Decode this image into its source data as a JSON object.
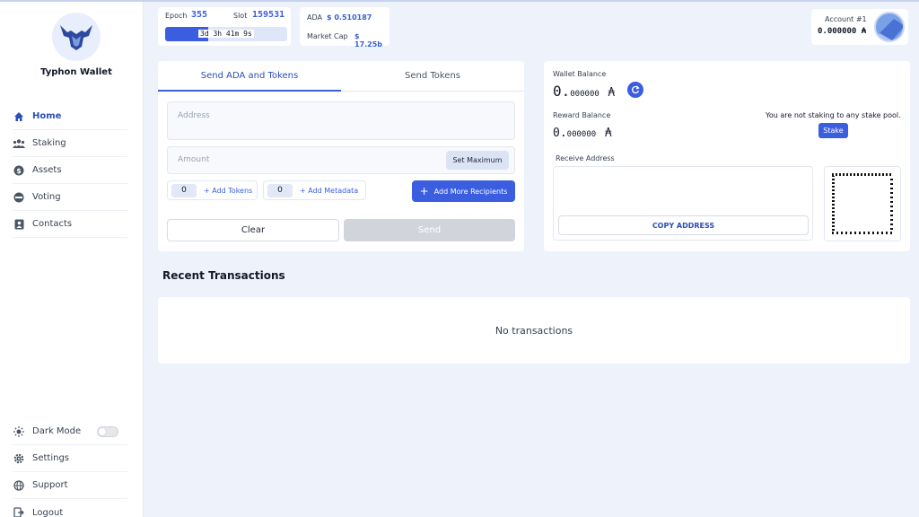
{
  "brand": {
    "name": "Typhon Wallet"
  },
  "sidebar": {
    "items": [
      {
        "label": "Home",
        "icon": "home-icon"
      },
      {
        "label": "Staking",
        "icon": "users-icon"
      },
      {
        "label": "Assets",
        "icon": "dollar-icon"
      },
      {
        "label": "Voting",
        "icon": "vote-icon"
      },
      {
        "label": "Contacts",
        "icon": "contacts-icon"
      }
    ],
    "bottom": [
      {
        "label": "Dark Mode",
        "icon": "sun-icon"
      },
      {
        "label": "Settings",
        "icon": "gear-icon"
      },
      {
        "label": "Support",
        "icon": "globe-icon"
      },
      {
        "label": "Logout",
        "icon": "logout-icon"
      }
    ]
  },
  "epoch": {
    "epoch_label": "Epoch",
    "epoch_value": "355",
    "slot_label": "Slot",
    "slot_value": "159531",
    "remaining": "3d 3h 41m 9s",
    "progress_fraction": 0.35
  },
  "price": {
    "ada_label": "ADA",
    "ada_value": "$ 0.510187",
    "mcap_label": "Market Cap",
    "mcap_value": "$ 17.25b"
  },
  "account": {
    "name": "Account #1",
    "balance": "0.000000 ₳"
  },
  "send": {
    "tab_active": "Send ADA and Tokens",
    "tab_other": "Send Tokens",
    "address_placeholder": "Address",
    "amount_placeholder": "Amount",
    "set_max": "Set Maximum",
    "tokens_count": "0",
    "add_tokens": "+ Add Tokens",
    "metadata_count": "0",
    "add_metadata": "+ Add Metadata",
    "add_recipients": "Add More Recipients",
    "clear": "Clear",
    "send": "Send"
  },
  "wallet": {
    "wallet_balance_label": "Wallet Balance",
    "wallet_int": "0.",
    "wallet_dec": "000000",
    "wallet_sym": "₳",
    "reward_label": "Reward Balance",
    "reward_int": "0.",
    "reward_dec": "000000",
    "reward_sym": "₳",
    "stake_notice": "You are not staking to any stake pool.",
    "stake_button": "Stake",
    "receive_label": "Receive Address",
    "copy_address": "COPY ADDRESS"
  },
  "transactions": {
    "title": "Recent Transactions",
    "empty": "No transactions"
  },
  "colors": {
    "accent": "#3b5ee0",
    "background": "#eef2fb"
  }
}
